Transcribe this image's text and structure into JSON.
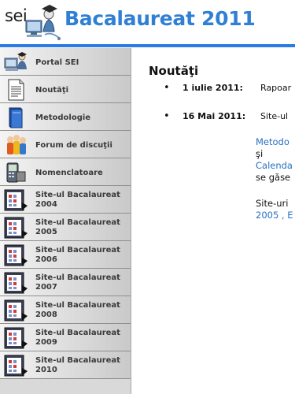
{
  "header": {
    "logo_text": "sei",
    "title": "Bacalaureat 2011"
  },
  "sidebar": {
    "items": [
      {
        "label": "Portal SEI",
        "icon": "computer-user-icon"
      },
      {
        "label": "Noutăţi",
        "icon": "document-icon"
      },
      {
        "label": "Metodologie",
        "icon": "book-icon"
      },
      {
        "label": "Forum de discuţii",
        "icon": "people-icon"
      },
      {
        "label": "Nomenclatoare",
        "icon": "handheld-icon"
      },
      {
        "label": "Site-ul Bacalaureat 2004",
        "icon": "calendar-icon"
      },
      {
        "label": "Site-ul Bacalaureat 2005",
        "icon": "calendar-icon"
      },
      {
        "label": "Site-ul Bacalaureat 2006",
        "icon": "calendar-icon"
      },
      {
        "label": "Site-ul Bacalaureat 2007",
        "icon": "calendar-icon"
      },
      {
        "label": "Site-ul Bacalaureat 2008",
        "icon": "calendar-icon"
      },
      {
        "label": "Site-ul Bacalaureat 2009",
        "icon": "calendar-icon"
      },
      {
        "label": "Site-ul Bacalaureat 2010",
        "icon": "calendar-icon"
      }
    ]
  },
  "main": {
    "heading": "Noutăţi",
    "news": [
      {
        "date": "1 iulie 2011:",
        "text": "Rapoar"
      },
      {
        "date": "16 Mai 2011:",
        "text": "Site-ul"
      }
    ],
    "paragraph1": {
      "link1": "Metodo",
      "conj": "şi",
      "link2": "Calenda",
      "text": "se găse"
    },
    "paragraph2": {
      "text": "Site-uri",
      "link1": "2005",
      "sep": " , ",
      "link2": "E"
    }
  },
  "colors": {
    "title_blue": "#2f7fd4",
    "bar_blue": "#2c7be0",
    "link_blue": "#2a6fc1",
    "sidebar_gray": "#d9d9d9"
  }
}
